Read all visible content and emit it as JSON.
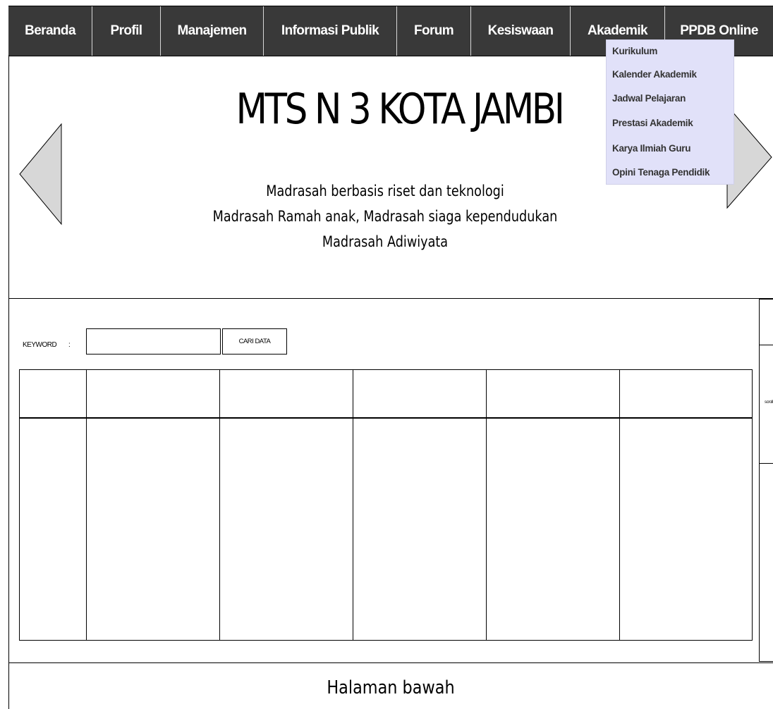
{
  "nav": {
    "items": [
      {
        "label": "Beranda"
      },
      {
        "label": "Profil"
      },
      {
        "label": "Manajemen"
      },
      {
        "label": "Informasi Publik"
      },
      {
        "label": "Forum"
      },
      {
        "label": "Kesiswaan"
      },
      {
        "label": "Akademik"
      },
      {
        "label": "PPDB Online"
      }
    ],
    "background_color": "#393939",
    "text_color": "#ffffff"
  },
  "dropdown": {
    "parent": "Akademik",
    "background_color": "#e1e1f9",
    "items": [
      {
        "label": "Kurikulum"
      },
      {
        "label": "Kalender Akademik"
      },
      {
        "label": "Jadwal Pelajaran"
      },
      {
        "label": "Prestasi Akademik"
      },
      {
        "label": "Karya Ilmiah Guru"
      },
      {
        "label": "Opini Tenaga Pendidik"
      }
    ]
  },
  "hero": {
    "title": "MTS N 3 KOTA JAMBI",
    "taglines": [
      "Madrasah berbasis riset dan teknologi",
      "Madrasah Ramah anak, Madrasah  siaga kependudukan",
      "Madrasah Adiwiyata"
    ],
    "prev_icon": "triangle-left-icon",
    "next_icon": "triangle-right-icon"
  },
  "search": {
    "label": "KEYWORD",
    "separator": ":",
    "value": "",
    "button_label": "CARI DATA"
  },
  "table": {
    "headers": [
      "",
      "",
      "",
      "",
      "",
      ""
    ],
    "rows": [
      [
        "",
        "",
        "",
        "",
        "",
        ""
      ]
    ]
  },
  "scrollbar": {
    "label": "scroll"
  },
  "footer": {
    "text": "Halaman bawah"
  }
}
